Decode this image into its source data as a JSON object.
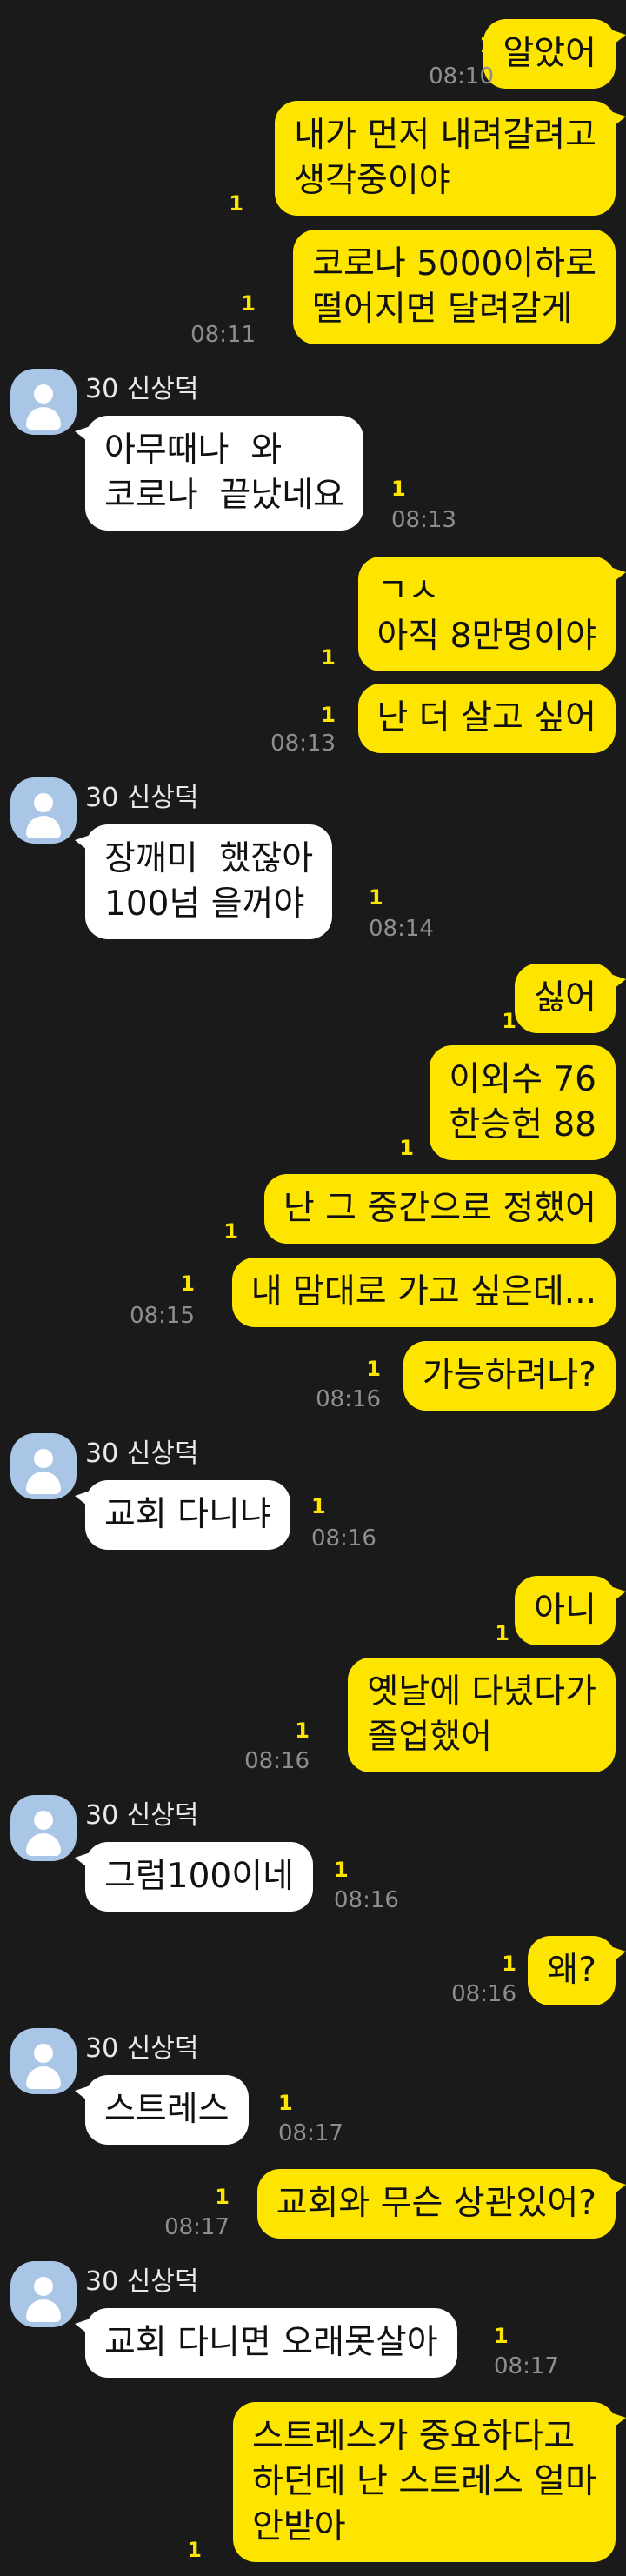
{
  "sender_name": "30 신상덕",
  "unread_marker": "1",
  "messages": [
    {
      "text": "알았어",
      "time": "08:10"
    },
    {
      "text": "내가 먼저 내려갈려고\n생각중이야",
      "time": ""
    },
    {
      "text": "코로나 5000이하로\n떨어지면 달려갈게",
      "time": "08:11"
    },
    {
      "text": "아무때나  와\n코로나  끝났네요",
      "time": "08:13"
    },
    {
      "text": "ㄱㅅ\n아직 8만명이야",
      "time": ""
    },
    {
      "text": "난 더 살고 싶어",
      "time": "08:13"
    },
    {
      "text": "장깨미  했잖아\n100넘 을꺼야",
      "time": "08:14"
    },
    {
      "text": "싫어",
      "time": ""
    },
    {
      "text": "이외수 76\n한승헌 88",
      "time": ""
    },
    {
      "text": "난 그 중간으로 정했어",
      "time": ""
    },
    {
      "text": "내 맘대로 가고 싶은데...",
      "time": "08:15"
    },
    {
      "text": "가능하려나?",
      "time": "08:16"
    },
    {
      "text": "교회 다니냐",
      "time": "08:16"
    },
    {
      "text": "아니",
      "time": ""
    },
    {
      "text": "옛날에 다녔다가\n졸업했어",
      "time": "08:16"
    },
    {
      "text": "그럼100이네",
      "time": "08:16"
    },
    {
      "text": "왜?",
      "time": "08:16"
    },
    {
      "text": "스트레스",
      "time": "08:17"
    },
    {
      "text": "교회와 무슨 상관있어?",
      "time": "08:17"
    },
    {
      "text": "교회 다니면 오래못살아",
      "time": "08:17"
    },
    {
      "text": "스트레스가 중요하다고\n하던데 난 스트레스 얼마\n안받아",
      "time": ""
    }
  ]
}
